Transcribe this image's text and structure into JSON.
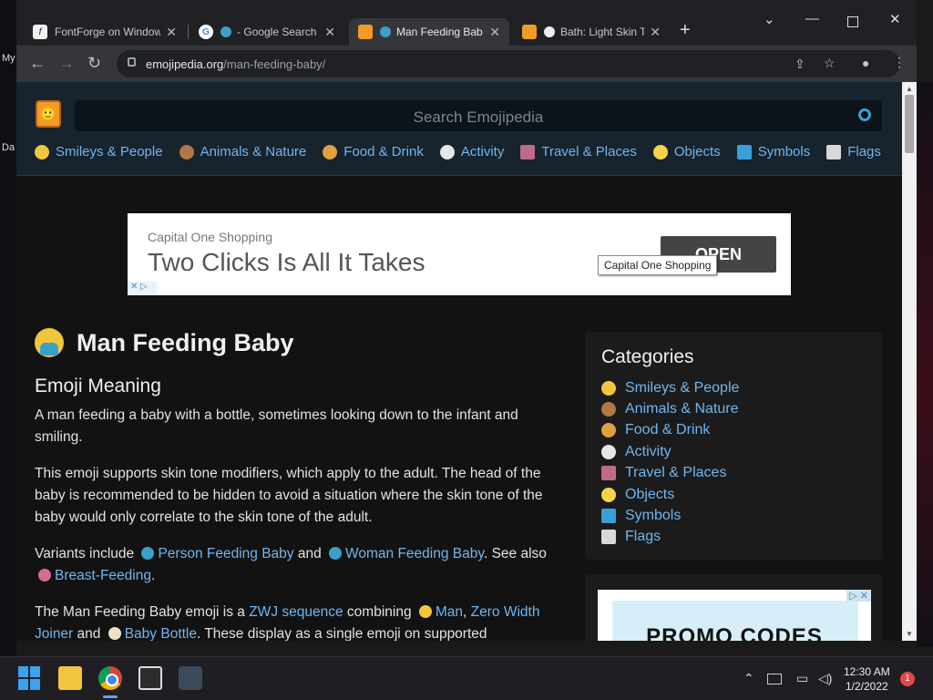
{
  "desktop": {
    "left_labels": [
      "My",
      "",
      "Da"
    ]
  },
  "tabs": [
    {
      "title": "FontForge on Window",
      "favicon": "fontforge-icon",
      "active": false
    },
    {
      "title": "- Google Search",
      "favicon": "google-icon",
      "active": false
    },
    {
      "title": "Man Feeding Bab",
      "favicon": "emojipedia-icon",
      "active": true
    },
    {
      "title": "Bath: Light Skin T",
      "favicon": "emojipedia-icon",
      "active": false
    }
  ],
  "toolbar": {
    "url_domain": "emojipedia.org",
    "url_path": "/man-feeding-baby/"
  },
  "site": {
    "search_placeholder": "Search Emojipedia",
    "nav": [
      {
        "label": "Smileys & People",
        "color": "#f2c53d"
      },
      {
        "label": "Animals & Nature",
        "color": "#b07845"
      },
      {
        "label": "Food & Drink",
        "color": "#e0a040"
      },
      {
        "label": "Activity",
        "color": "#e6e6e6"
      },
      {
        "label": "Travel & Places",
        "color": "#c06a8a"
      },
      {
        "label": "Objects",
        "color": "#f8d34a"
      },
      {
        "label": "Symbols",
        "color": "#3a9fd8"
      },
      {
        "label": "Flags",
        "color": "#d8d8d8"
      }
    ]
  },
  "ad": {
    "sponsor": "Capital One Shopping",
    "headline": "Two Clicks Is All It Takes",
    "button": "OPEN",
    "tooltip": "Capital One Shopping",
    "adchoice": "✕ ▷"
  },
  "article": {
    "title": "Man Feeding Baby",
    "meaning_heading": "Emoji Meaning",
    "p1": "A man feeding a baby with a bottle, sometimes looking down to the infant and smiling.",
    "p2": "This emoji supports skin tone modifiers, which apply to the adult. The head of the baby is recommended to be hidden to avoid a situation where the skin tone of the baby would only correlate to the skin tone of the adult.",
    "p3": {
      "pre": "Variants include",
      "link1": "Person Feeding Baby",
      "and": "and",
      "link2": "Woman Feeding Baby",
      "see_also": ". See also",
      "link3": "Breast-Feeding",
      "end": "."
    },
    "p4": {
      "pre": "The Man Feeding Baby emoji is a",
      "link1": "ZWJ sequence",
      "combining": "combining",
      "link2": "Man",
      "link3": "Zero Width Joiner",
      "and": "and",
      "link4": "Baby Bottle",
      "end": ". These display as a single emoji on supported"
    }
  },
  "sidebar": {
    "heading": "Categories",
    "items": [
      {
        "label": "Smileys & People",
        "color": "#f2c53d"
      },
      {
        "label": "Animals & Nature",
        "color": "#b07845"
      },
      {
        "label": "Food & Drink",
        "color": "#e0a040"
      },
      {
        "label": "Activity",
        "color": "#e6e6e6"
      },
      {
        "label": "Travel & Places",
        "color": "#c06a8a"
      },
      {
        "label": "Objects",
        "color": "#f8d34a"
      },
      {
        "label": "Symbols",
        "color": "#3a9fd8"
      },
      {
        "label": "Flags",
        "color": "#d8d8d8"
      }
    ]
  },
  "promo": {
    "text": "PROMO CODES"
  },
  "taskbar": {
    "time": "12:30 AM",
    "date": "1/2/2022",
    "notifications": "1"
  }
}
